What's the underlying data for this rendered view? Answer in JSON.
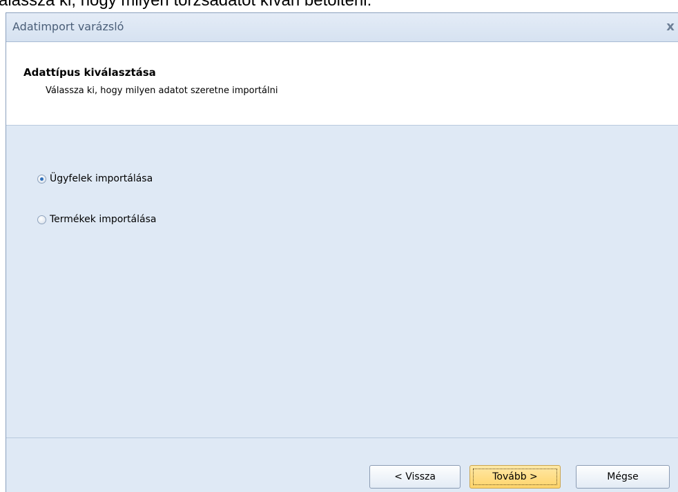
{
  "background": {
    "caption_fragment": "álassza ki, hogy milyen törzsadatot kíván betölteni:"
  },
  "window": {
    "title": "Adatimport varázsló",
    "close_glyph": "x"
  },
  "header": {
    "title": "Adattípus kiválasztása",
    "subtitle": "Válassza ki, hogy milyen adatot szeretne importálni"
  },
  "options": [
    {
      "label": "Ügyfelek importálása",
      "checked": true
    },
    {
      "label": "Termékek importálása",
      "checked": false
    }
  ],
  "buttons": {
    "back": "< Vissza",
    "next": "Tovább >",
    "cancel": "Mégse"
  },
  "colors": {
    "dialog_background": "#dfe9f5",
    "header_background": "#ffffff",
    "default_button": "#ffd46a",
    "title_text": "#4a5e78"
  }
}
